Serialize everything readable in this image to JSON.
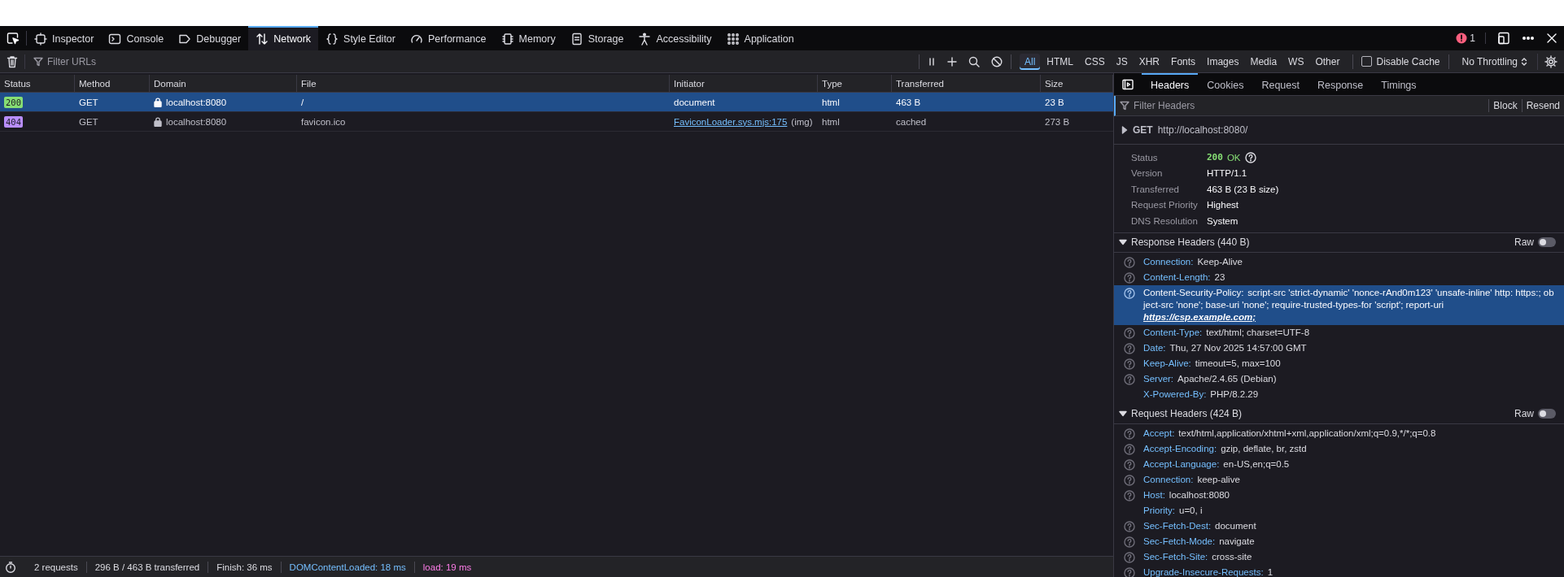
{
  "devtools_tabs": [
    {
      "label": "Inspector",
      "selected": false
    },
    {
      "label": "Console",
      "selected": false
    },
    {
      "label": "Debugger",
      "selected": false
    },
    {
      "label": "Network",
      "selected": true
    },
    {
      "label": "Style Editor",
      "selected": false
    },
    {
      "label": "Performance",
      "selected": false
    },
    {
      "label": "Memory",
      "selected": false
    },
    {
      "label": "Storage",
      "selected": false
    },
    {
      "label": "Accessibility",
      "selected": false
    },
    {
      "label": "Application",
      "selected": false
    }
  ],
  "error_count": "1",
  "filter": {
    "placeholder": "Filter URLs"
  },
  "type_filters": [
    {
      "label": "All",
      "selected": true
    },
    {
      "label": "HTML",
      "selected": false
    },
    {
      "label": "CSS",
      "selected": false
    },
    {
      "label": "JS",
      "selected": false
    },
    {
      "label": "XHR",
      "selected": false
    },
    {
      "label": "Fonts",
      "selected": false
    },
    {
      "label": "Images",
      "selected": false
    },
    {
      "label": "Media",
      "selected": false
    },
    {
      "label": "WS",
      "selected": false
    },
    {
      "label": "Other",
      "selected": false
    }
  ],
  "disable_cache": {
    "label": "Disable Cache",
    "checked": false
  },
  "throttling": {
    "value": "No Throttling"
  },
  "table": {
    "columns": [
      "Status",
      "Method",
      "Domain",
      "File",
      "Initiator",
      "Type",
      "Transferred",
      "Size"
    ],
    "rows": [
      {
        "status": "200",
        "color": "#86de74",
        "method": "GET",
        "domain": "localhost:8080",
        "file": "/",
        "initiator": "document",
        "type": "html",
        "transferred": "463 B",
        "size": "23 B",
        "selected": true
      },
      {
        "status": "404",
        "color": "#b98eff",
        "method": "GET",
        "domain": "localhost:8080",
        "file": "favicon.ico",
        "initiator_link": "FaviconLoader.sys.mjs:175",
        "initiator": "(img)",
        "type": "html",
        "transferred": "cached",
        "size": "273 B",
        "selected": false
      }
    ]
  },
  "status_bar": [
    {
      "text": "2 requests",
      "color": "#dcdce2"
    },
    {
      "text": "296 B / 463 B transferred",
      "color": "#dcdce2"
    },
    {
      "text": "Finish: 36 ms",
      "color": "#dcdce2"
    },
    {
      "text": "DOMContentLoaded: 18 ms",
      "color": "#75bfff"
    },
    {
      "text": "load: 19 ms",
      "color": "#ff7de9"
    }
  ],
  "details": {
    "tabs": [
      {
        "label": "Headers",
        "selected": true
      },
      {
        "label": "Cookies",
        "selected": false
      },
      {
        "label": "Request",
        "selected": false
      },
      {
        "label": "Response",
        "selected": false
      },
      {
        "label": "Timings",
        "selected": false
      }
    ],
    "filter": {
      "placeholder": "Filter Headers"
    },
    "buttons": [
      "Block",
      "Resend"
    ],
    "request_line": {
      "expanded": false,
      "method": "GET",
      "url": "http://localhost:8080/"
    },
    "summary": [
      {
        "kind": "status",
        "label": "Status",
        "value": "200",
        "note": "OK"
      },
      {
        "kind": "text",
        "label": "Version",
        "value": "HTTP/1.1"
      },
      {
        "kind": "text",
        "label": "Transferred",
        "value": "463 B (23 B size)"
      },
      {
        "kind": "text",
        "label": "Request Priority",
        "value": "Highest"
      },
      {
        "kind": "text",
        "label": "DNS Resolution",
        "value": "System"
      }
    ],
    "sections": [
      {
        "title": "Response Headers (440 B)",
        "expanded": true,
        "raw_label": "Raw",
        "raw_on": false,
        "headers": [
          {
            "name": "Connection:",
            "value": "Keep-Alive",
            "help": true,
            "selected": false
          },
          {
            "name": "Content-Length:",
            "value": "23",
            "help": true,
            "selected": false
          },
          {
            "name": "Content-Security-Policy:",
            "value": "script-src 'strict-dynamic' 'nonce-rAnd0m123' 'unsafe-inline' http: https:; object-src 'none'; base-uri 'none'; require-trusted-types-for 'script'; report-uri",
            "link": "https://csp.example.com;",
            "help": true,
            "selected": true
          },
          {
            "name": "Content-Type:",
            "value": "text/html; charset=UTF-8",
            "help": true,
            "selected": false
          },
          {
            "name": "Date:",
            "value": "Thu, 27 Nov 2025 14:57:00 GMT",
            "help": true,
            "selected": false
          },
          {
            "name": "Keep-Alive:",
            "value": "timeout=5, max=100",
            "help": true,
            "selected": false
          },
          {
            "name": "Server:",
            "value": "Apache/2.4.65 (Debian)",
            "help": true,
            "selected": false
          },
          {
            "name": "X-Powered-By:",
            "value": "PHP/8.2.29",
            "help": false,
            "selected": false
          }
        ]
      },
      {
        "title": "Request Headers (424 B)",
        "expanded": true,
        "raw_label": "Raw",
        "raw_on": false,
        "headers": [
          {
            "name": "Accept:",
            "value": "text/html,application/xhtml+xml,application/xml;q=0.9,*/*;q=0.8",
            "help": true,
            "selected": false
          },
          {
            "name": "Accept-Encoding:",
            "value": "gzip, deflate, br, zstd",
            "help": true,
            "selected": false
          },
          {
            "name": "Accept-Language:",
            "value": "en-US,en;q=0.5",
            "help": true,
            "selected": false
          },
          {
            "name": "Connection:",
            "value": "keep-alive",
            "help": true,
            "selected": false
          },
          {
            "name": "Host:",
            "value": "localhost:8080",
            "help": true,
            "selected": false
          },
          {
            "name": "Priority:",
            "value": "u=0, i",
            "help": false,
            "selected": false
          },
          {
            "name": "Sec-Fetch-Dest:",
            "value": "document",
            "help": true,
            "selected": false
          },
          {
            "name": "Sec-Fetch-Mode:",
            "value": "navigate",
            "help": true,
            "selected": false
          },
          {
            "name": "Sec-Fetch-Site:",
            "value": "cross-site",
            "help": true,
            "selected": false
          },
          {
            "name": "Upgrade-Insecure-Requests:",
            "value": "1",
            "help": true,
            "selected": false
          }
        ]
      }
    ]
  }
}
